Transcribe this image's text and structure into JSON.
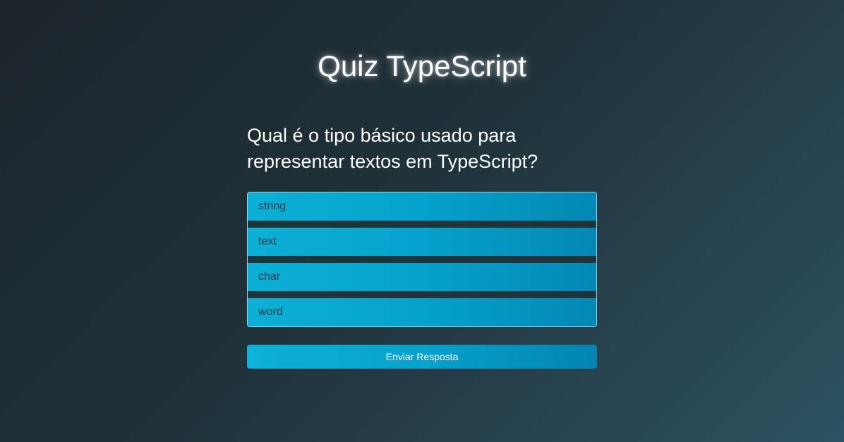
{
  "page": {
    "title": "Quiz TypeScript"
  },
  "quiz": {
    "question": "Qual é o tipo básico usado para representar textos em TypeScript?",
    "options": [
      {
        "label": "string"
      },
      {
        "label": "text"
      },
      {
        "label": "char"
      },
      {
        "label": "word"
      }
    ],
    "submit_label": "Enviar Resposta"
  },
  "colors": {
    "background": "#1f3139",
    "accent": "#04a2cc",
    "option_text": "#1e3a45"
  }
}
